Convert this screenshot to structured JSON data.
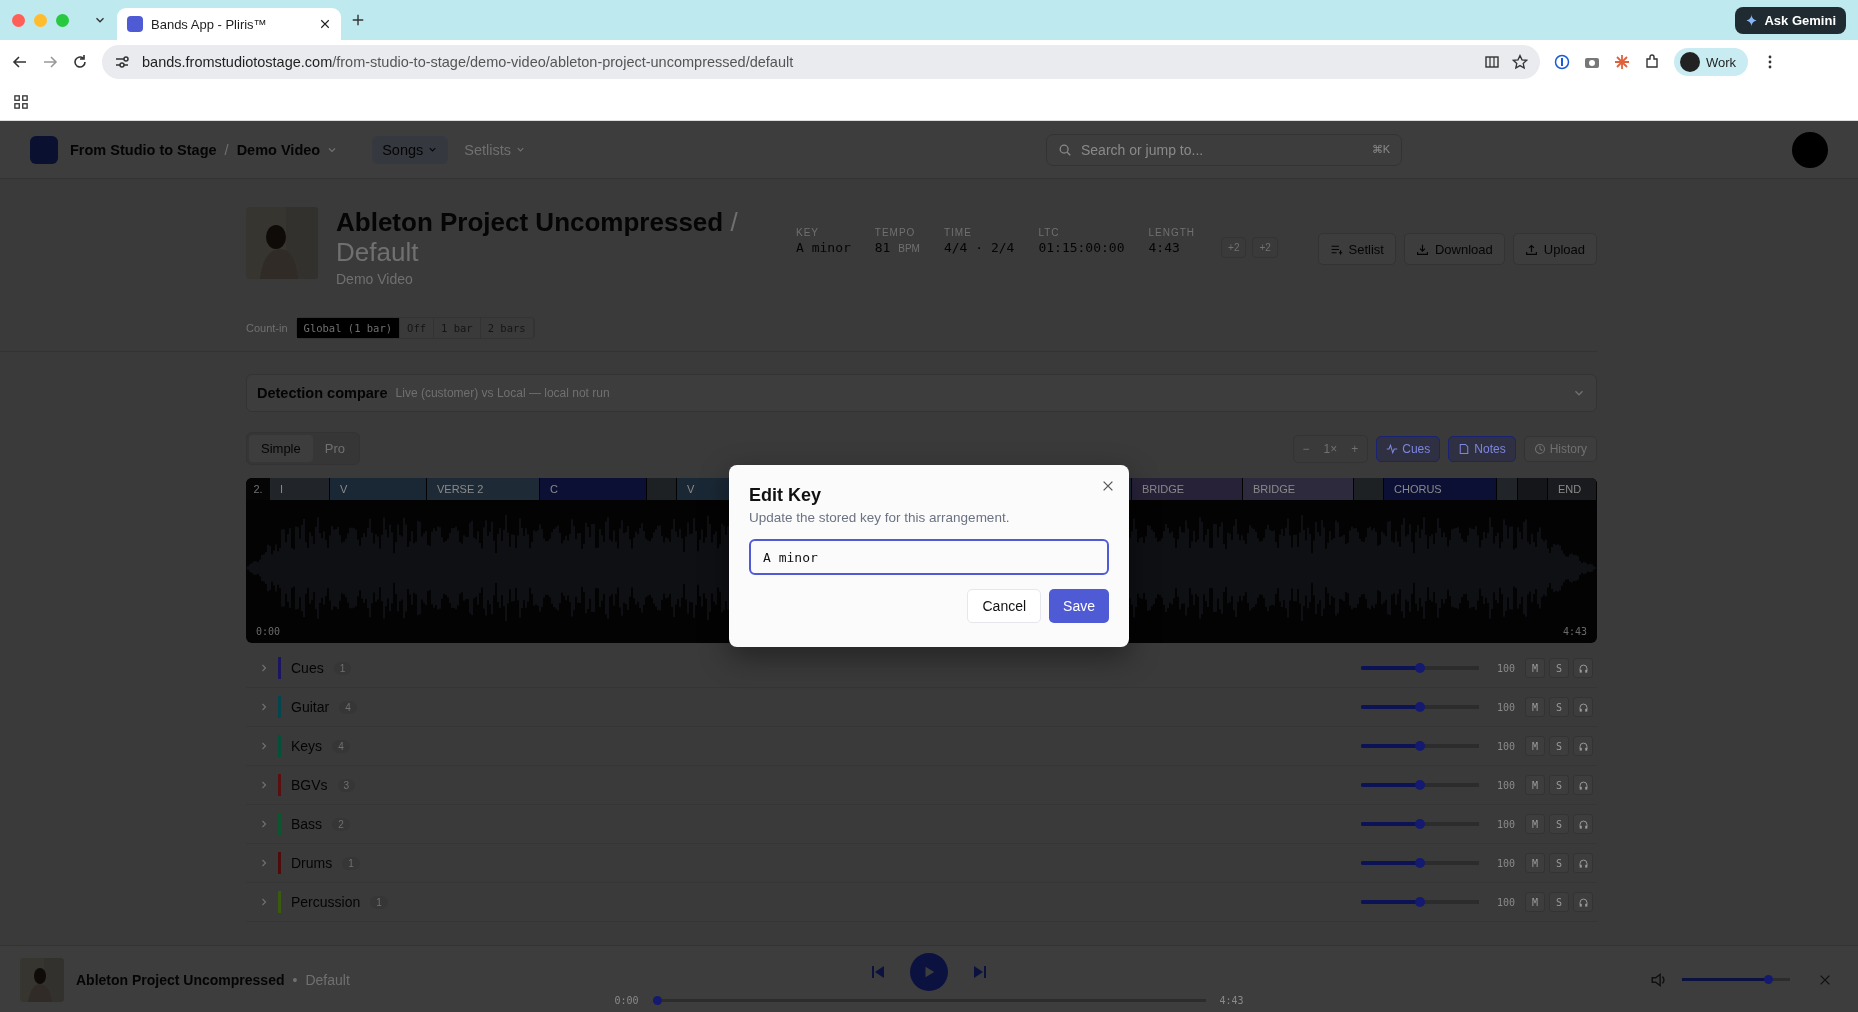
{
  "browser": {
    "tab_title": "Bands App - Pliris™",
    "url_host": "bands.fromstudiotostage.com",
    "url_path": "/from-studio-to-stage/demo-video/ableton-project-uncompressed/default",
    "ask_button": "Ask Gemini",
    "profile": "Work"
  },
  "app_header": {
    "breadcrumb": [
      "From Studio to Stage",
      "Demo Video"
    ],
    "separator": "/",
    "nav": [
      {
        "label": "Songs",
        "selected": true
      },
      {
        "label": "Setlists",
        "selected": false
      }
    ],
    "search": {
      "placeholder": "Search or jump to...",
      "shortcut": "⌘K"
    }
  },
  "song": {
    "title": "Ableton Project Uncompressed",
    "separator": "/",
    "arrangement": "Default",
    "artist": "Demo Video",
    "stats": [
      {
        "label": "KEY",
        "value": "A minor"
      },
      {
        "label": "TEMPO",
        "value": "81",
        "unit": "BPM"
      },
      {
        "label": "TIME",
        "value": "4/4 · 2/4"
      },
      {
        "label": "LTC",
        "value": "01:15:00:00"
      },
      {
        "label": "LENGTH",
        "value": "4:43"
      }
    ],
    "chips": [
      "+2",
      "+2"
    ],
    "actions": [
      {
        "label": "Setlist",
        "kind": "list"
      },
      {
        "label": "Download",
        "kind": "download"
      },
      {
        "label": "Upload",
        "kind": "upload"
      }
    ]
  },
  "count_in": {
    "label": "Count-in",
    "options": [
      {
        "label": "Global (1 bar)",
        "selected": true
      },
      {
        "label": "Off",
        "selected": false
      },
      {
        "label": "1 bar",
        "selected": false
      },
      {
        "label": "2 bars",
        "selected": false
      }
    ]
  },
  "detection": {
    "title": "Detection compare",
    "subtitle": "Live (customer) vs Local — local not run"
  },
  "view_modes": [
    {
      "label": "Simple",
      "selected": true
    },
    {
      "label": "Pro",
      "selected": false
    }
  ],
  "zoom": {
    "minus": "−",
    "value": "1×",
    "plus": "+"
  },
  "toggles": [
    {
      "label": "Cues",
      "on": true,
      "kind": "wave"
    },
    {
      "label": "Notes",
      "on": true,
      "kind": "note"
    },
    {
      "label": "History",
      "on": false,
      "kind": "clock"
    }
  ],
  "waveform": {
    "marker": "2.",
    "start_time": "0:00",
    "end_time": "4:43",
    "sections": [
      {
        "label": "I",
        "color": "#212529"
      },
      {
        "label": "V",
        "color": "#1a2835"
      },
      {
        "label": "VERSE 2",
        "color": "#1e2b37"
      },
      {
        "label": "C",
        "color": "#0c1034"
      },
      {
        "color": "#1e2124"
      },
      {
        "label": "V",
        "color": "#1a2835"
      },
      {
        "label": "BRIDGE",
        "color": "#282238"
      },
      {
        "label": "BRIDGE",
        "color": "#2e2a3d"
      },
      {
        "color": "#1e2124"
      },
      {
        "label": "CHORUS",
        "color": "#0c1034"
      },
      {
        "color": "#212529"
      },
      {
        "color": "#15161a"
      },
      {
        "label": "END",
        "color": "#1a1b1e"
      }
    ]
  },
  "tracks": [
    {
      "name": "Cues",
      "count": "1",
      "color": "#1c1660",
      "level": 0.5,
      "volume": "100",
      "mute": "M",
      "solo": "S"
    },
    {
      "name": "Guitar",
      "count": "4",
      "color": "#05454d",
      "level": 0.5,
      "volume": "100",
      "mute": "M",
      "solo": "S"
    },
    {
      "name": "Keys",
      "count": "4",
      "color": "#06503a",
      "level": 0.5,
      "volume": "100",
      "mute": "M",
      "solo": "S"
    },
    {
      "name": "BGVs",
      "count": "3",
      "color": "#5a1010",
      "level": 0.5,
      "volume": "100",
      "mute": "M",
      "solo": "S"
    },
    {
      "name": "Bass",
      "count": "2",
      "color": "#0e5430",
      "level": 0.5,
      "volume": "100",
      "mute": "M",
      "solo": "S"
    },
    {
      "name": "Drums",
      "count": "1",
      "color": "#4e0c0c",
      "level": 0.5,
      "volume": "100",
      "mute": "M",
      "solo": "S"
    },
    {
      "name": "Percussion",
      "count": "1",
      "color": "#3a5a10",
      "level": 0.5,
      "volume": "100",
      "mute": "M",
      "solo": "S"
    }
  ],
  "player": {
    "title": "Ableton Project Uncompressed",
    "separator": "•",
    "arrangement": "Default",
    "elapsed": "0:00",
    "total": "4:43",
    "progress": {
      "level": 0
    },
    "volume": {
      "level": 0.8
    }
  },
  "modal": {
    "title": "Edit Key",
    "description": "Update the stored key for this arrangement.",
    "value": "A minor",
    "cancel": "Cancel",
    "save": "Save"
  }
}
